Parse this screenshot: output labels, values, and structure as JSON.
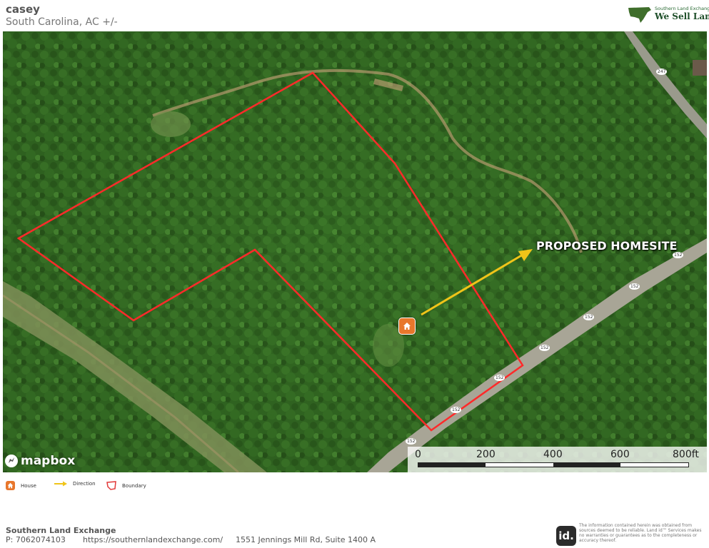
{
  "header": {
    "title": "casey",
    "subtitle": "South Carolina,  AC +/-",
    "logo_small_text": "Southern Land Exchange",
    "logo_big_text": "We Sell Land."
  },
  "map": {
    "annotation_label": "PROPOSED HOMESITE",
    "attribution": "mapbox",
    "road_labels": [
      "247",
      "152",
      "152",
      "152",
      "152",
      "152",
      "152",
      "152"
    ],
    "scale": {
      "labels": [
        "0",
        "200",
        "400",
        "600",
        "800ft"
      ]
    },
    "colors": {
      "boundary": "#ff2a2a",
      "direction_arrow": "#f0c419",
      "house_marker": "#e8772c"
    }
  },
  "legend": {
    "items": [
      {
        "icon": "house-icon",
        "label": "House"
      },
      {
        "icon": "direction-arrow-icon",
        "label": "Direction"
      },
      {
        "icon": "boundary-icon",
        "label": "Boundary"
      }
    ]
  },
  "footer": {
    "company": "Southern Land Exchange",
    "phone": "P: 7062074103",
    "url": "https://southernlandexchange.com/",
    "address": "1551 Jennings Mill Rd, Suite 1400 A",
    "id_logo_text": "id.",
    "disclaimer": "The information contained herein was obtained from sources deemed to be reliable. Land id™ Services makes no warranties or guarantees as to the completeness or accuracy thereof."
  }
}
